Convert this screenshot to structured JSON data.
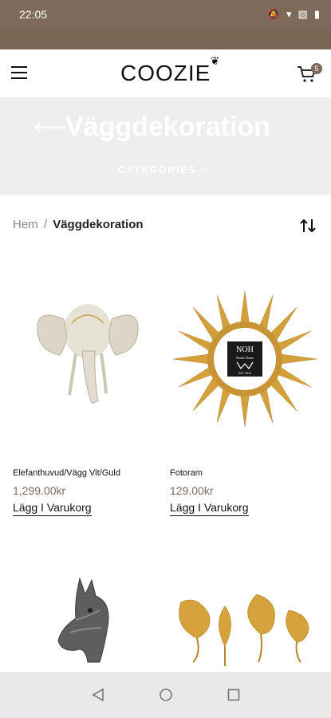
{
  "status_bar": {
    "time": "22:05",
    "icons": [
      "bell-mute-icon",
      "wifi-icon",
      "signal-icon",
      "battery-icon"
    ]
  },
  "header": {
    "logo": "COOZIE",
    "cart_count": "5"
  },
  "hero": {
    "title": "Väggdekoration",
    "categories_label": "CATEGORIES"
  },
  "breadcrumb": {
    "home": "Hem",
    "separator": "/",
    "current": "Väggdekoration"
  },
  "products": [
    {
      "name": "Elefanthuvud/Vägg Vit/Guld",
      "price": "1,299.00kr",
      "cta": "Lägg I Varukorg",
      "image": "elephant-head"
    },
    {
      "name": "Fotoram",
      "price": "129.00kr",
      "cta": "Lägg I Varukorg",
      "image": "sunburst-frame"
    },
    {
      "name": "",
      "price": "",
      "cta": "",
      "image": "zebra-head"
    },
    {
      "name": "",
      "price": "",
      "cta": "",
      "image": "gold-leaves"
    }
  ],
  "frame_label": {
    "line1": "NOH",
    "line2": "Nordic Home",
    "line3": "EST. 2014"
  },
  "nav": {
    "back": "back-icon",
    "home": "home-icon",
    "recent": "recent-apps-icon"
  },
  "colors": {
    "brand": "#7d6a5b",
    "accent_price": "#7d6a5b",
    "hero_bg": "#eeeeee",
    "nav_bg": "#e9e9e9"
  }
}
